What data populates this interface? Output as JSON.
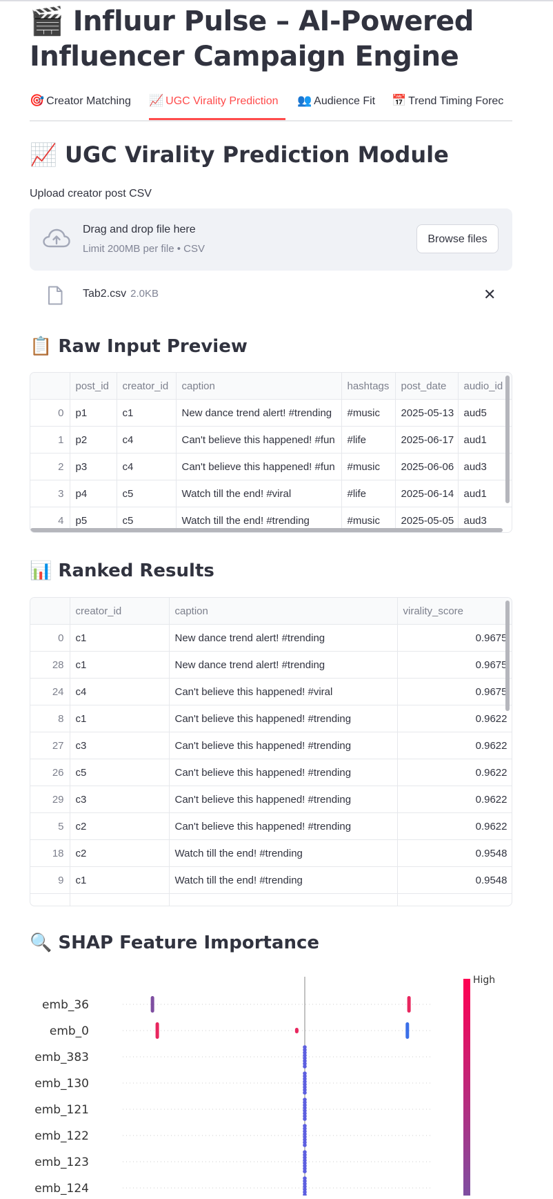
{
  "app": {
    "title": "🎬 Influur Pulse – AI-Powered Influencer Campaign Engine"
  },
  "tabs": [
    {
      "icon": "🎯",
      "label": "Creator Matching",
      "active": false
    },
    {
      "icon": "📈",
      "label": "UGC Virality Prediction",
      "active": true
    },
    {
      "icon": "👥",
      "label": "Audience Fit",
      "active": false
    },
    {
      "icon": "📅",
      "label": "Trend Timing Forec",
      "active": false
    }
  ],
  "module": {
    "title": "📈 UGC Virality Prediction Module"
  },
  "uploader": {
    "label": "Upload creator post CSV",
    "drag_text": "Drag and drop file here",
    "limit_text": "Limit 200MB per file • CSV",
    "browse_label": "Browse files",
    "icon": "cloud-upload-icon"
  },
  "uploaded_file": {
    "name": "Tab2.csv",
    "size": "2.0KB",
    "icon": "file-icon",
    "remove_icon": "close-icon"
  },
  "raw_preview": {
    "title": "📋 Raw Input Preview",
    "columns": [
      "",
      "post_id",
      "creator_id",
      "caption",
      "hashtags",
      "post_date",
      "audio_id"
    ],
    "rows": [
      [
        "0",
        "p1",
        "c1",
        "New dance trend alert! #trending",
        "#music",
        "2025-05-13",
        "aud5"
      ],
      [
        "1",
        "p2",
        "c4",
        "Can't believe this happened! #fun",
        "#life",
        "2025-06-17",
        "aud1"
      ],
      [
        "2",
        "p3",
        "c4",
        "Can't believe this happened! #fun",
        "#music",
        "2025-06-06",
        "aud3"
      ],
      [
        "3",
        "p4",
        "c5",
        "Watch till the end! #viral",
        "#life",
        "2025-06-14",
        "aud1"
      ],
      [
        "4",
        "p5",
        "c5",
        "Watch till the end! #trending",
        "#music",
        "2025-05-05",
        "aud3"
      ]
    ]
  },
  "ranked": {
    "title": "📊 Ranked Results",
    "columns": [
      "",
      "creator_id",
      "caption",
      "virality_score"
    ],
    "rows": [
      [
        "0",
        "c1",
        "New dance trend alert! #trending",
        "0.9675"
      ],
      [
        "28",
        "c1",
        "New dance trend alert! #trending",
        "0.9675"
      ],
      [
        "24",
        "c4",
        "Can't believe this happened! #viral",
        "0.9675"
      ],
      [
        "8",
        "c1",
        "Can't believe this happened! #trending",
        "0.9622"
      ],
      [
        "27",
        "c3",
        "Can't believe this happened! #trending",
        "0.9622"
      ],
      [
        "26",
        "c5",
        "Can't believe this happened! #trending",
        "0.9622"
      ],
      [
        "29",
        "c3",
        "Can't believe this happened! #trending",
        "0.9622"
      ],
      [
        "5",
        "c2",
        "Can't believe this happened! #trending",
        "0.9622"
      ],
      [
        "18",
        "c2",
        "Watch till the end! #trending",
        "0.9548"
      ],
      [
        "9",
        "c1",
        "Watch till the end! #trending",
        "0.9548"
      ]
    ]
  },
  "shap": {
    "title": "🔍 SHAP Feature Importance",
    "colorbar_high_label": "High",
    "colors": {
      "high": "#ff0052",
      "low": "#008bfb",
      "mid": "#7e4ea1"
    }
  },
  "chart_data": {
    "type": "scatter",
    "title": "",
    "xlabel": "",
    "ylabel": "",
    "features": [
      "emb_36",
      "emb_0",
      "emb_383",
      "emb_130",
      "emb_121",
      "emb_122",
      "emb_123",
      "emb_124"
    ],
    "points": [
      {
        "feature": "emb_36",
        "shap": -0.95,
        "color": "#7e4ea1"
      },
      {
        "feature": "emb_36",
        "shap": 0.65,
        "color": "#e8265e"
      },
      {
        "feature": "emb_0",
        "shap": -0.92,
        "color": "#e8265e"
      },
      {
        "feature": "emb_0",
        "shap": -0.05,
        "color": "#e8265e"
      },
      {
        "feature": "emb_0",
        "shap": 0.64,
        "color": "#3b6fe8"
      },
      {
        "feature": "emb_383",
        "shap": 0.0,
        "color": "#c83a8e"
      },
      {
        "feature": "emb_130",
        "shap": 0.0,
        "color": "#c83a8e"
      },
      {
        "feature": "emb_121",
        "shap": 0.0,
        "color": "#c83a8e"
      },
      {
        "feature": "emb_122",
        "shap": 0.0,
        "color": "#c83a8e"
      },
      {
        "feature": "emb_123",
        "shap": 0.0,
        "color": "#c83a8e"
      },
      {
        "feature": "emb_124",
        "shap": 0.0,
        "color": "#c83a8e"
      }
    ],
    "xlim": [
      -1.2,
      0.8
    ],
    "colorbar": "feature value (High at top)",
    "grid": false,
    "legend": "colorbar right"
  }
}
